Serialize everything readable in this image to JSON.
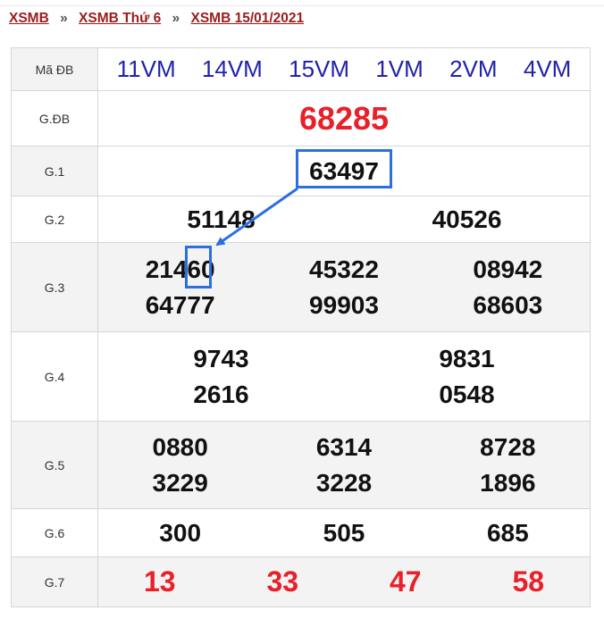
{
  "breadcrumb": [
    "XSMB",
    "XSMB Thứ 6",
    "XSMB 15/01/2021"
  ],
  "breadcrumb_sep": "»",
  "table": {
    "code_label": "Mã ĐB",
    "codes": [
      "11VM",
      "14VM",
      "15VM",
      "1VM",
      "2VM",
      "4VM"
    ],
    "rows": [
      {
        "label": "G.ĐB",
        "numbers": [
          "68285"
        ]
      },
      {
        "label": "G.1",
        "numbers": [
          "63497"
        ]
      },
      {
        "label": "G.2",
        "numbers": [
          "51148",
          "40526"
        ]
      },
      {
        "label": "G.3",
        "numbers": [
          "21460",
          "45322",
          "08942",
          "64777",
          "99903",
          "68603"
        ]
      },
      {
        "label": "G.4",
        "numbers": [
          "9743",
          "9831",
          "2616",
          "0548"
        ]
      },
      {
        "label": "G.5",
        "numbers": [
          "0880",
          "6314",
          "8728",
          "3229",
          "3228",
          "1896"
        ]
      },
      {
        "label": "G.6",
        "numbers": [
          "300",
          "505",
          "685"
        ]
      },
      {
        "label": "G.7",
        "numbers": [
          "13",
          "33",
          "47",
          "58"
        ]
      }
    ]
  },
  "colors": {
    "accent_red": "#e8202a",
    "code_blue": "#2222aa",
    "highlight_blue": "#2b6fe0",
    "breadcrumb": "#9b1c1c"
  }
}
